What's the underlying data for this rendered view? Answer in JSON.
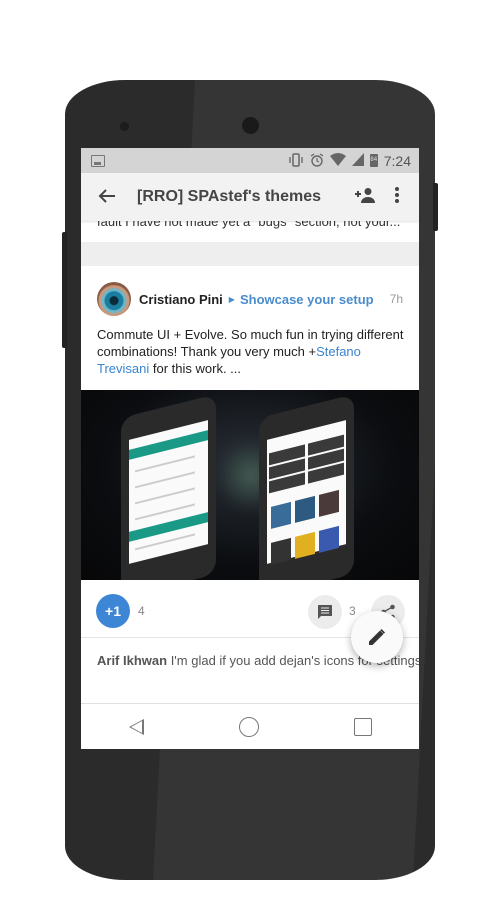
{
  "status_bar": {
    "battery_level": "84",
    "time": "7:24",
    "icons": [
      "image-notification-icon",
      "vibrate-icon",
      "alarm-icon",
      "wifi-icon",
      "signal-icon",
      "battery-icon"
    ]
  },
  "app_bar": {
    "back_icon": "arrow-back-icon",
    "title": "[RRO] SPAstef's themes",
    "add_person_icon": "person-add-icon",
    "more_icon": "more-vert-icon"
  },
  "previous_post": {
    "snippet": "fault I have not made yet a \"bugs\" section, not your..."
  },
  "post": {
    "author": "Cristiano Pini",
    "community": "Showcase your setup",
    "age": "7h",
    "text_before": "Commute UI + Evolve. So much fun in trying different combinations! Thank you very much +",
    "mention": "Stefano Trevisani",
    "text_after": " for this work. ...",
    "image_alt": "Two phones showing themed Settings and Google Play screens",
    "plus_one_label": "+1",
    "plus_one_count": "4",
    "comment_count": "3"
  },
  "comment": {
    "author": "Arif Ikhwan",
    "text": " I'm glad if you add dejan's icons for settings and system ui tiles too.. +Stefano Tre"
  },
  "fab": {
    "icon": "edit-pencil-icon"
  },
  "colors": {
    "accent_blue": "#3d86d6",
    "link_blue": "#4a8ccc",
    "phone_body": "#2b2b2b",
    "status_bar": "#d4d4d4"
  }
}
